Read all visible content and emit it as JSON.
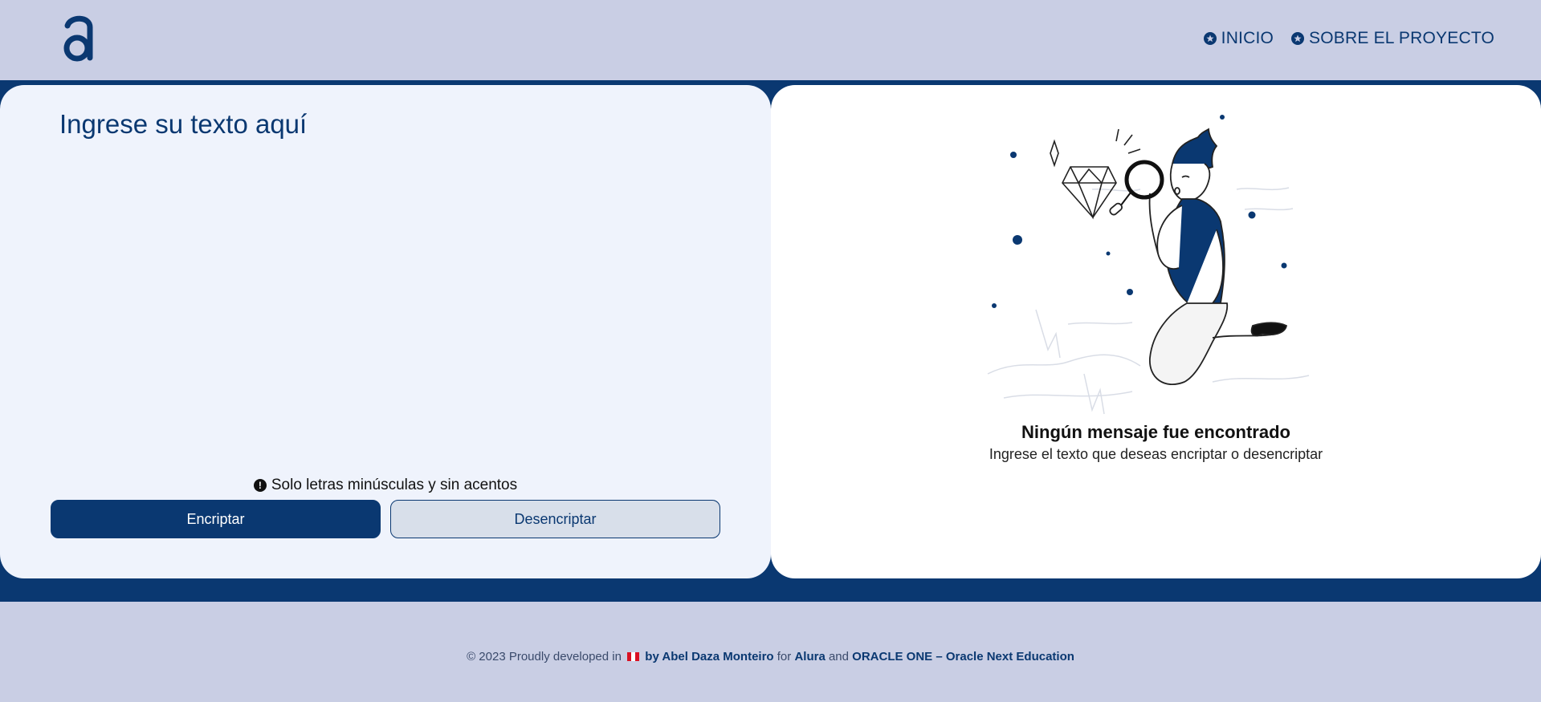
{
  "header": {
    "logo_alt": "Alura logo",
    "nav": [
      {
        "label": "INICIO",
        "icon": "star-circle-icon"
      },
      {
        "label": "SOBRE EL PROYECTO",
        "icon": "star-circle-icon"
      }
    ]
  },
  "editor": {
    "placeholder": "Ingrese su texto aquí",
    "value": "",
    "hint_icon": "exclamation-circle-icon",
    "hint": "Solo letras minúsculas y sin acentos",
    "encrypt_label": "Encriptar",
    "decrypt_label": "Desencriptar"
  },
  "output": {
    "illustration": "person-with-magnifier-and-diamond",
    "title": "Ningún mensaje fue encontrado",
    "subtitle": "Ingrese el texto que deseas encriptar o desencriptar"
  },
  "footer": {
    "prefix": "© 2023 Proudly developed in",
    "author": "by Abel Daza Monteiro",
    "for_word": "for",
    "org1": "Alura",
    "and_word": "and",
    "org2": "ORACLE ONE – Oracle Next Education"
  },
  "colors": {
    "primary": "#0a3871",
    "header_bg": "#c9cee4",
    "panel_left_bg": "#eff3fc",
    "panel_right_bg": "#ffffff"
  }
}
